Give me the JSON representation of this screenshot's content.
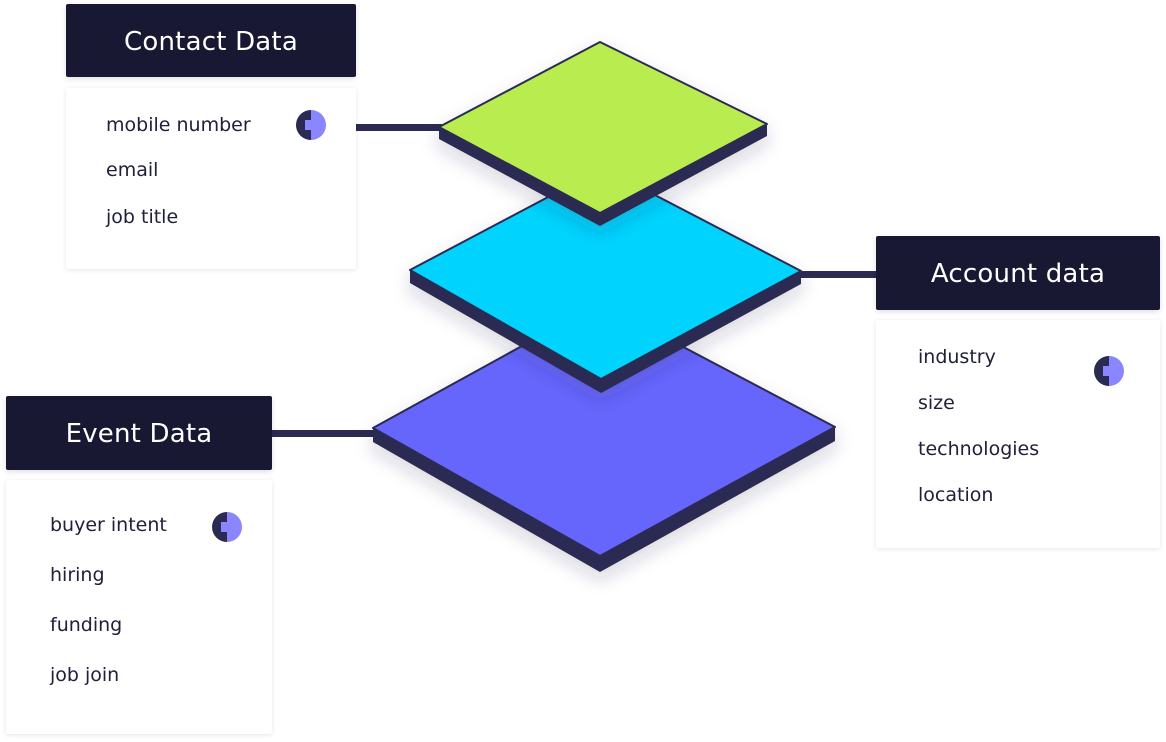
{
  "colors": {
    "header_bg": "#181833",
    "connector": "#2b2a52",
    "layer_edge": "#2b2a52",
    "contact_layer": "#b8ec4f",
    "account_layer": "#00d4fe",
    "event_layer": "#6666fd",
    "badge_dark": "#2b2a52",
    "badge_light": "#8a86ff"
  },
  "panels": {
    "contact": {
      "title": "Contact Data",
      "items": [
        "mobile number",
        "email",
        "job title"
      ],
      "badge_icon": "half-circle-badge-icon"
    },
    "account": {
      "title": "Account data",
      "items": [
        "industry",
        "size",
        "technologies",
        "location"
      ],
      "badge_icon": "half-circle-badge-icon"
    },
    "event": {
      "title": "Event Data",
      "items": [
        "buyer intent",
        "hiring",
        "funding",
        "job join"
      ],
      "badge_icon": "half-circle-badge-icon"
    }
  },
  "layers": [
    {
      "name": "event-layer",
      "color_key": "event_layer",
      "linked_panel": "event"
    },
    {
      "name": "account-layer",
      "color_key": "account_layer",
      "linked_panel": "account"
    },
    {
      "name": "contact-layer",
      "color_key": "contact_layer",
      "linked_panel": "contact"
    }
  ]
}
